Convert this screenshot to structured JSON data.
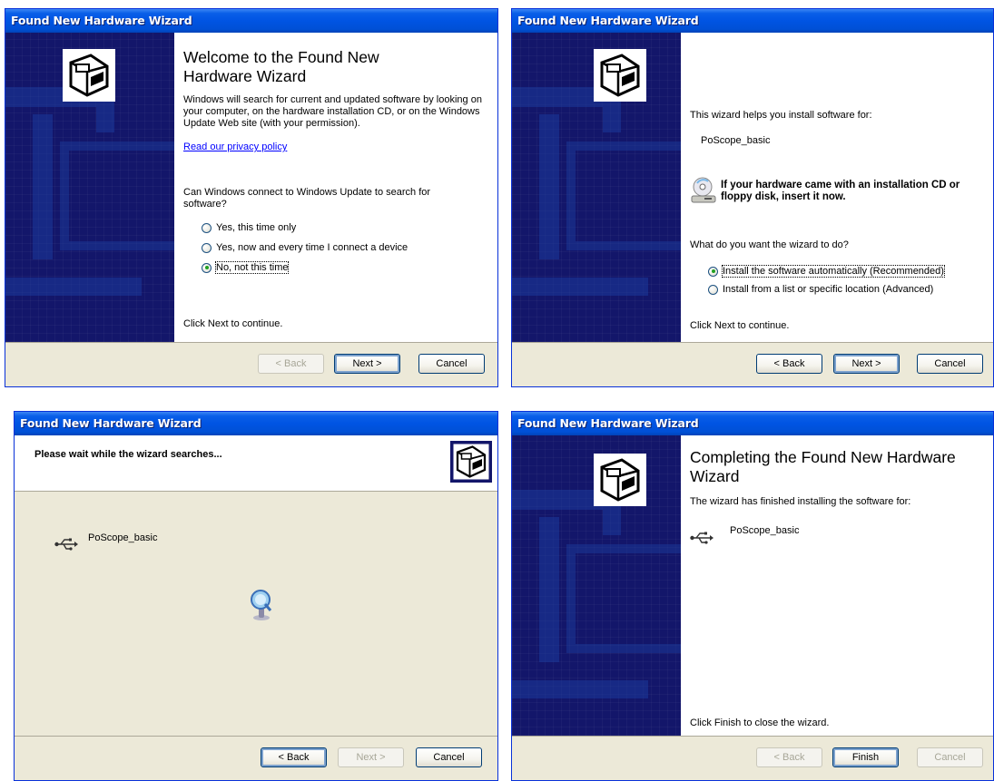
{
  "window_title": "Found New Hardware Wizard",
  "buttons": {
    "back": "< Back",
    "next": "Next >",
    "cancel": "Cancel",
    "finish": "Finish"
  },
  "panel1": {
    "heading": "Welcome to the Found New Hardware Wizard",
    "intro": "Windows will search for current and updated software by looking on your computer, on the hardware installation CD, or on the Windows Update Web site (with your permission).",
    "privacy_link": "Read our privacy policy",
    "question": "Can Windows connect to Windows Update to search for software?",
    "options": [
      "Yes, this time only",
      "Yes, now and every time I connect a device",
      "No, not this time"
    ],
    "selected_option": 2,
    "footer_text": "Click Next to continue."
  },
  "panel2": {
    "intro": "This wizard helps you install software for:",
    "device": "PoScope_basic",
    "cd_notice": "If your hardware came with an installation CD or floppy disk, insert it now.",
    "question": "What do you want the wizard to do?",
    "options": [
      "Install the software automatically (Recommended)",
      "Install from a list or specific location (Advanced)"
    ],
    "selected_option": 0,
    "footer_text": "Click Next to continue."
  },
  "panel3": {
    "header": "Please wait while the wizard searches...",
    "device": "PoScope_basic"
  },
  "panel4": {
    "heading": "Completing the Found New Hardware Wizard",
    "intro": "The wizard has finished installing the software for:",
    "device": "PoScope_basic",
    "footer_text": "Click Finish to close the wizard."
  },
  "colors": {
    "title_bar": "#0054e3",
    "side_panel": "#13166a",
    "dialog_face": "#ece9d8",
    "link": "#0000ff"
  },
  "icons": [
    "hardware-wizard-icon",
    "cd-drive-icon",
    "usb-icon",
    "search-magnifier-icon"
  ]
}
